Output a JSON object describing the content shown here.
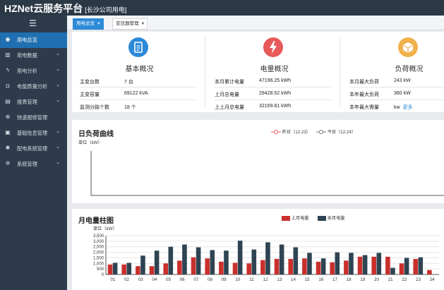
{
  "app": {
    "title": "HZNet云服务平台",
    "subtitle": "[长沙公司用电]"
  },
  "sidebar": {
    "items": [
      {
        "label": "用电总览",
        "icon": "eye-icon",
        "chevron": false,
        "active": true
      },
      {
        "label": "用电数据",
        "icon": "bar-chart-icon",
        "chevron": true,
        "active": false
      },
      {
        "label": "用电分析",
        "icon": "bolt-icon",
        "chevron": true,
        "active": false
      },
      {
        "label": "电能质量分析",
        "icon": "camera-icon",
        "chevron": true,
        "active": false
      },
      {
        "label": "报表管理",
        "icon": "file-icon",
        "chevron": true,
        "active": false
      },
      {
        "label": "快速报修管理",
        "icon": "plus-circle-icon",
        "chevron": false,
        "active": false
      },
      {
        "label": "基础信息管理",
        "icon": "id-card-icon",
        "chevron": true,
        "active": false
      },
      {
        "label": "配电系统管理",
        "icon": "gear-icon",
        "chevron": true,
        "active": false
      },
      {
        "label": "系统管理",
        "icon": "gears-icon",
        "chevron": true,
        "active": false
      }
    ]
  },
  "tabs": [
    {
      "label": "用电总览",
      "active": true,
      "close": "×"
    },
    {
      "label": "变压器管理",
      "active": false,
      "close": "×"
    }
  ],
  "overview": {
    "basic": {
      "title": "基本概况",
      "icon": "document-icon",
      "color": "#2d8ad8",
      "rows": [
        {
          "k": "主变台数",
          "v": "7 台"
        },
        {
          "k": "主变容量",
          "v": "69122 kVA"
        },
        {
          "k": "监测分路个数",
          "v": "18 个"
        }
      ]
    },
    "energy": {
      "title": "电量概况",
      "icon": "bolt-icon",
      "color": "#e85a5a",
      "rows": [
        {
          "k": "本月累计电量",
          "v": "47196.25 kWh"
        },
        {
          "k": "上月总电量",
          "v": "29428.52 kWh"
        },
        {
          "k": "上上月总电量",
          "v": "32169.81 kWh"
        }
      ]
    },
    "load": {
      "title": "负荷概况",
      "icon": "box-icon",
      "color": "#f0b04a",
      "rows": [
        {
          "k": "本月最大负荷",
          "v": "243 kW"
        },
        {
          "k": "本年最大负荷",
          "v": "360 kW"
        },
        {
          "k": "本年最大需量",
          "v": "kw",
          "link": "更多"
        }
      ]
    }
  },
  "daily": {
    "title": "日负荷曲线",
    "unit": "单位（kW）",
    "legend": [
      {
        "label": "昨日（12.23）",
        "color": "#e55a5a"
      },
      {
        "label": "今日（12.24）",
        "color": "#777777"
      }
    ]
  },
  "monthly": {
    "title": "月电量柱图",
    "unit": "单位（kW）"
  },
  "chart_data": [
    {
      "type": "line",
      "title": "日负荷曲线",
      "ylabel": "单位（kW）",
      "series": [
        {
          "name": "昨日（12.23）",
          "values": []
        },
        {
          "name": "今日（12.24）",
          "values": []
        }
      ],
      "legend": "top-center"
    },
    {
      "type": "bar",
      "title": "月电量柱图",
      "ylabel": "单位（kW）",
      "categories": [
        "01",
        "02",
        "03",
        "04",
        "05",
        "06",
        "07",
        "08",
        "09",
        "10",
        "11",
        "12",
        "13",
        "14",
        "15",
        "16",
        "17",
        "18",
        "19",
        "20",
        "21",
        "22",
        "23",
        "24"
      ],
      "ylim": [
        0,
        3500
      ],
      "yticks": [
        "0",
        "500",
        "1,000",
        "1,500",
        "2,000",
        "2,500",
        "3,000",
        "3,500"
      ],
      "series": [
        {
          "name": "上月电量",
          "color": "#c9302c",
          "values": [
            900,
            900,
            750,
            750,
            1000,
            1250,
            1550,
            1450,
            1150,
            1050,
            1000,
            1300,
            1400,
            1400,
            1450,
            1150,
            1100,
            1250,
            1600,
            1600,
            1600,
            1000,
            1400,
            400
          ]
        },
        {
          "name": "本月电量",
          "color": "#2e4453",
          "values": [
            1050,
            1050,
            1700,
            2150,
            2500,
            2700,
            2450,
            2200,
            2150,
            3050,
            2250,
            2900,
            2700,
            2450,
            1950,
            1450,
            2000,
            1950,
            1750,
            1950,
            600,
            1500,
            1550,
            0
          ]
        }
      ],
      "legend": "top-center"
    }
  ]
}
